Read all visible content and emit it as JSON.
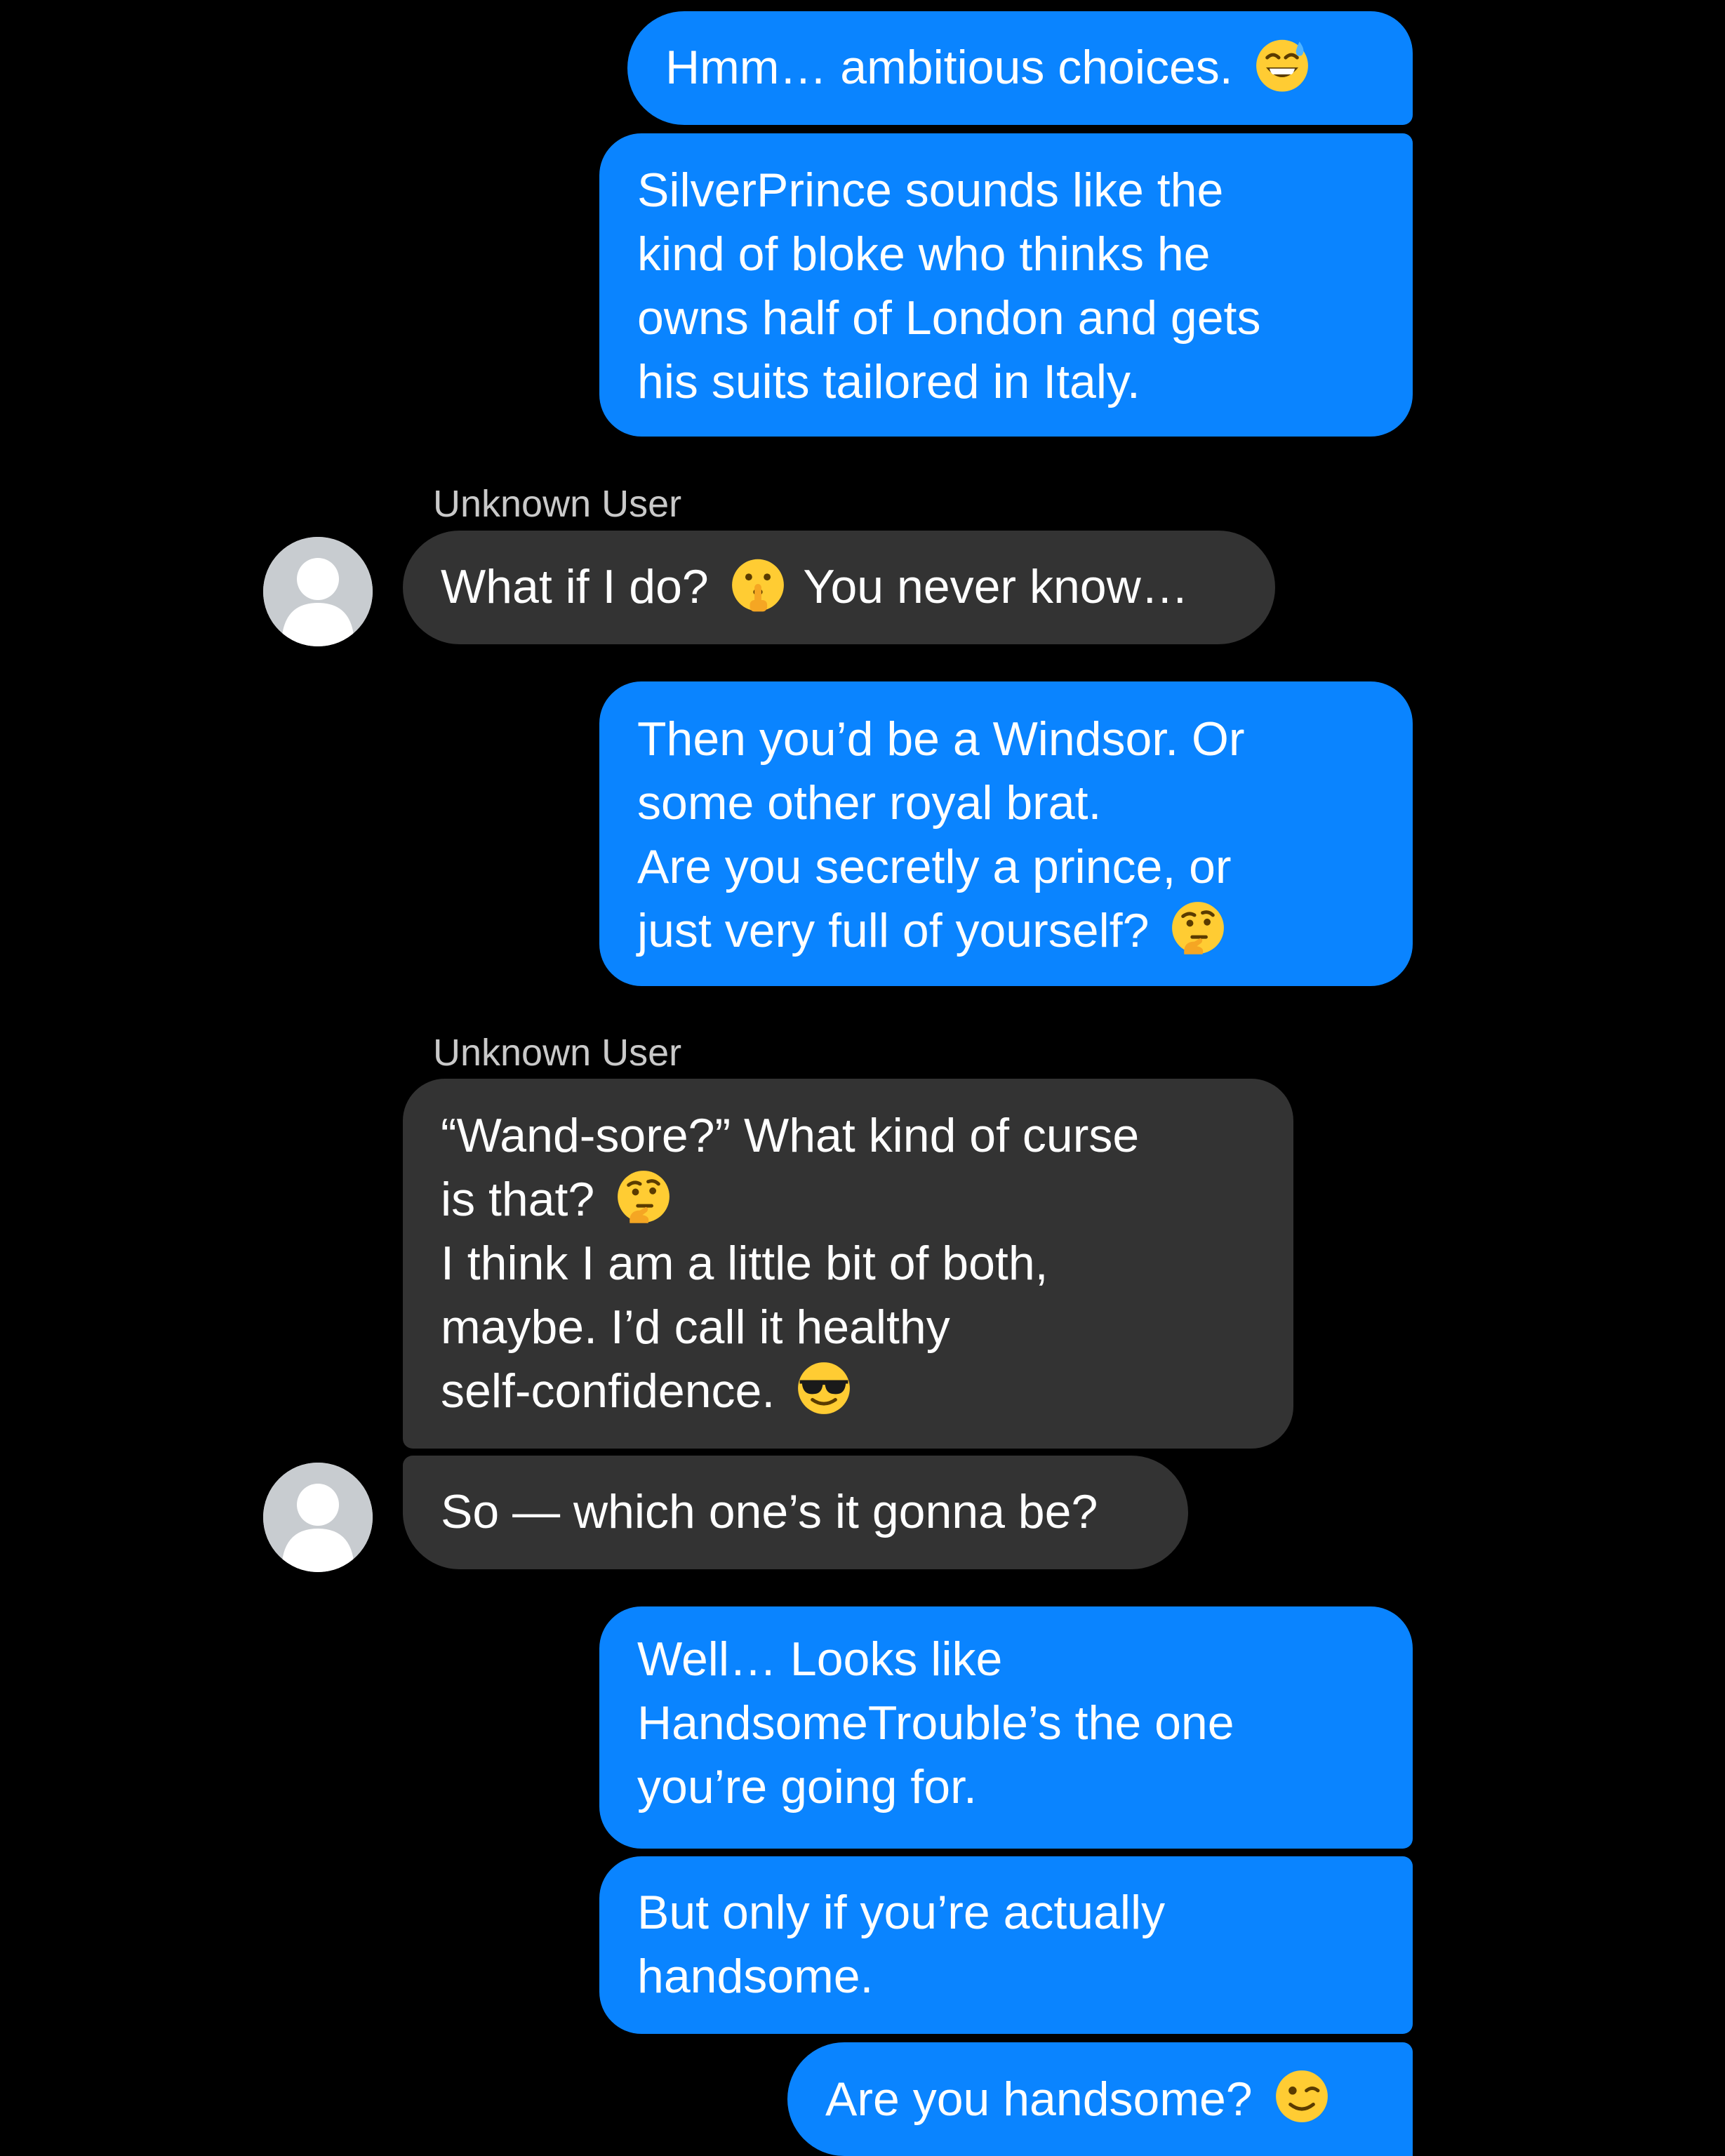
{
  "conversation": {
    "sender_name_1": "Unknown User",
    "sender_name_2": "Unknown User",
    "messages": [
      {
        "direction": "outgoing",
        "lines": [
          "Hmm… ambitious choices."
        ],
        "emoji": "sweat-smile-emoji"
      },
      {
        "direction": "outgoing",
        "lines": [
          "SilverPrince sounds like the",
          "kind of bloke who thinks he",
          "owns half of London and gets",
          "his suits tailored in Italy."
        ]
      },
      {
        "direction": "incoming",
        "lines": [
          "What if I do?",
          "You never know…"
        ],
        "emoji": "shushing-face-emoji"
      },
      {
        "direction": "outgoing",
        "lines": [
          "Then you’d be a Windsor. Or",
          "some other royal brat.",
          "Are you secretly a prince, or",
          "just very full of yourself?"
        ],
        "emoji": "thinking-face-emoji"
      },
      {
        "direction": "incoming",
        "lines": [
          "“Wand-sore?” What kind of curse",
          "is that?",
          "I think I am a little bit of both,",
          "maybe. I’d call it healthy",
          "self-confidence."
        ],
        "emoji": [
          "thinking-face-emoji",
          "sunglasses-face-emoji"
        ]
      },
      {
        "direction": "incoming",
        "lines": [
          "So — which one’s it gonna be?"
        ]
      },
      {
        "direction": "outgoing",
        "lines": [
          "Well… Looks like",
          "HandsomeTrouble’s the one",
          "you’re going for."
        ]
      },
      {
        "direction": "outgoing",
        "lines": [
          "But only if you’re actually",
          "handsome."
        ]
      },
      {
        "direction": "outgoing",
        "lines": [
          "Are you handsome?"
        ],
        "emoji": "winking-face-emoji"
      }
    ]
  },
  "colors": {
    "background": "#000000",
    "outgoing_bubble": "#0a84ff",
    "incoming_bubble": "#333333",
    "sender_name": "#c9c9c9",
    "avatar_bg": "#ffffff",
    "avatar_fg": "#c8ccd0"
  }
}
